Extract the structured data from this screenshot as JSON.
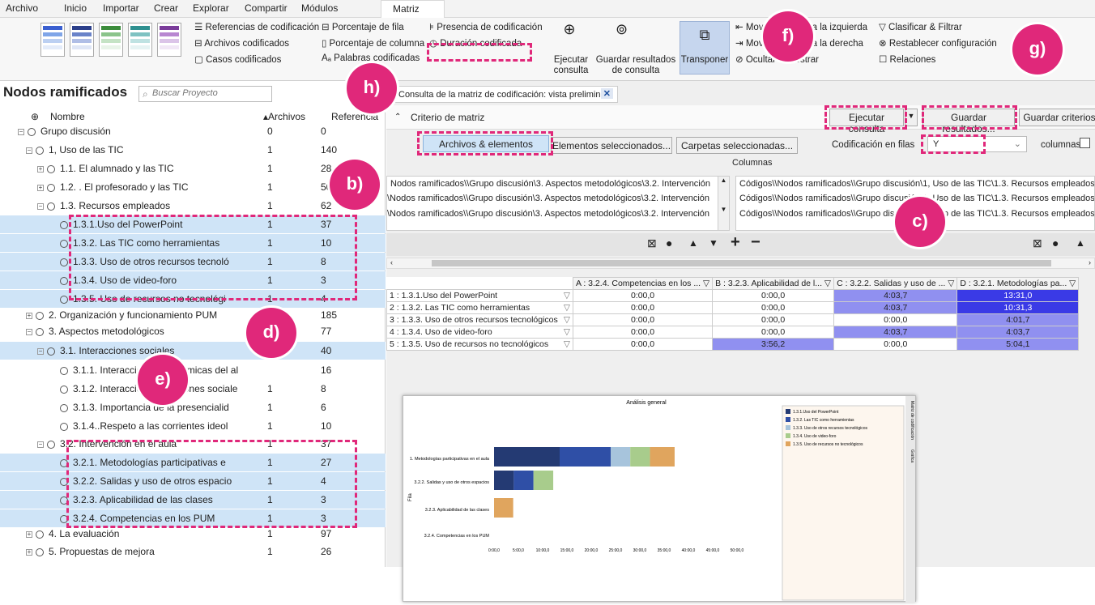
{
  "menu": [
    "Archivo",
    "Inicio",
    "Importar",
    "Crear",
    "Explorar",
    "Compartir",
    "Módulos",
    "Matriz"
  ],
  "ribbon": {
    "ref_cod": "Referencias de codificación",
    "arch_cod": "Archivos codificados",
    "casos_cod": "Casos codificados",
    "pct_fila": "Porcentaje de fila",
    "pct_col": "Porcentaje de columna",
    "palabras": "Palabras codificadas",
    "presencia": "Presencia de codificación",
    "duracion": "Duración codificada",
    "ejecutar": "Ejecutar consulta",
    "guardar_res": "Guardar resultados de consulta",
    "transponer": "Transponer",
    "mover_izq": "Mover columna a la izquierda",
    "mover_der": "Mover columna a la derecha",
    "ocultar": "Ocultar & mostrar",
    "clasificar": "Clasificar & Filtrar",
    "restablecer": "Restablecer configuración",
    "relaciones": "Relaciones"
  },
  "left": {
    "title": "Nodos ramificados",
    "search_placeholder": "Buscar Proyecto",
    "col_nombre": "Nombre",
    "col_archivos": "Archivos",
    "col_ref": "Referencia",
    "rows": [
      {
        "name": "Grupo discusión",
        "files": "0",
        "refs": "0"
      },
      {
        "name": "1, Uso de las TIC",
        "files": "1",
        "refs": "140"
      },
      {
        "name": "1.1. El alumnado y las TIC",
        "files": "1",
        "refs": "28"
      },
      {
        "name": "1.2. . El profesorado y las TIC",
        "files": "1",
        "refs": "50"
      },
      {
        "name": "1.3. Recursos empleados",
        "files": "1",
        "refs": "62"
      },
      {
        "name": "1.3.1.Uso del PowerPoint",
        "files": "1",
        "refs": "37"
      },
      {
        "name": "1.3.2. Las TIC como herramientas",
        "files": "1",
        "refs": "10"
      },
      {
        "name": "1.3.3. Uso de otros recursos tecnoló",
        "files": "1",
        "refs": "8"
      },
      {
        "name": "1.3.4. Uso de video-foro",
        "files": "1",
        "refs": "3"
      },
      {
        "name": "1.3.5. Uso de recursos no tecnológi",
        "files": "1",
        "refs": "4"
      },
      {
        "name": "2. Organización y funcionamiento PUM",
        "files": "",
        "refs": "185"
      },
      {
        "name": "3. Aspectos metodológicos",
        "files": "",
        "refs": "77"
      },
      {
        "name": "3.1. Interacciones sociales",
        "files": "",
        "refs": "40"
      },
      {
        "name": "3.1.1. Interacciones académicas del al",
        "files": "",
        "refs": "16"
      },
      {
        "name": "3.1.2. Interacciones relaciones sociale",
        "files": "1",
        "refs": "8"
      },
      {
        "name": "3.1.3. Importancia de la presencialid",
        "files": "1",
        "refs": "6"
      },
      {
        "name": "3.1.4..Respeto a las corrientes ideol",
        "files": "1",
        "refs": "10"
      },
      {
        "name": "3.2. Intervención en el aula",
        "files": "1",
        "refs": "37"
      },
      {
        "name": "3.2.1. Metodologías participativas e",
        "files": "1",
        "refs": "27"
      },
      {
        "name": "3.2.2. Salidas y uso de otros espacio",
        "files": "1",
        "refs": "4"
      },
      {
        "name": "3.2.3. Aplicabilidad de las clases",
        "files": "1",
        "refs": "3"
      },
      {
        "name": "3.2.4. Competencias en los PUM",
        "files": "1",
        "refs": "3"
      },
      {
        "name": "4. La evaluación",
        "files": "1",
        "refs": "97"
      },
      {
        "name": "5. Propuestas de mejora",
        "files": "1",
        "refs": "26"
      }
    ]
  },
  "tab": {
    "label": "Consulta de la matriz de codificación: vista prelimin"
  },
  "criteria": {
    "title": "Criterio de matriz",
    "ejecutar": "Ejecutar consulta",
    "guardar": "Guardar resultados...",
    "guardar_crit": "Guardar criterios",
    "tab1": "Archivos & elementos",
    "tab2": "Elementos seleccionados...",
    "tab3": "Carpetas seleccionadas...",
    "cod_filas": "Codificación en filas",
    "select_value": "Y",
    "columnas_lbl": "columnas",
    "columnas_hdr": "Columnas",
    "rows_left": [
      "Nodos ramificados\\\\Grupo discusión\\3. Aspectos metodológicos\\3.2. Intervención",
      "\\Nodos ramificados\\\\Grupo discusión\\3. Aspectos metodológicos\\3.2. Intervención",
      "\\Nodos ramificados\\\\Grupo discusión\\3. Aspectos metodológicos\\3.2. Intervención"
    ],
    "rows_right": [
      "Códigos\\\\Nodos ramificados\\\\Grupo discusión\\1, Uso de las TIC\\1.3. Recursos empleados\\1.",
      "Códigos\\\\Nodos ramificados\\\\Grupo discusión\\1, Uso de las TIC\\1.3. Recursos empleados\\1.",
      "Códigos\\\\Nodos ramificados\\\\Grupo discusión\\1, Uso de las TIC\\1.3. Recursos empleados\\1."
    ]
  },
  "matrix": {
    "headers": [
      "A : 3.2.4. Competencias en los ...",
      "B : 3.2.3. Aplicabilidad de l...",
      "C : 3.2.2. Salidas y uso de ...",
      "D : 3.2.1. Metodologías pa..."
    ],
    "rows": [
      {
        "label": "1 : 1.3.1.Uso del PowerPoint",
        "vals": [
          "0:00,0",
          "0:00,0",
          "4:03,7",
          "13:31,0"
        ]
      },
      {
        "label": "2 : 1.3.2. Las TIC como herramientas",
        "vals": [
          "0:00,0",
          "0:00,0",
          "4:03,7",
          "10:31,3"
        ]
      },
      {
        "label": "3 : 1.3.3. Uso de otros recursos tecnológicos",
        "vals": [
          "0:00,0",
          "0:00,0",
          "0:00,0",
          "4:01,7"
        ]
      },
      {
        "label": "4 : 1.3.4. Uso de video-foro",
        "vals": [
          "0:00,0",
          "0:00,0",
          "4:03,7",
          "4:03,7"
        ]
      },
      {
        "label": "5 : 1.3.5. Uso de recursos no tecnológicos",
        "vals": [
          "0:00,0",
          "3:56,2",
          "0:00,0",
          "5:04,1"
        ]
      }
    ]
  },
  "chart_data": {
    "type": "bar",
    "title": "Análisis general",
    "ylabel": "Fila",
    "categories": [
      "1. Metodologías participativas en el aula",
      "3.2.2. Salidas y uso de otros espacios",
      "3.2.3. Aplicabilidad de las clases",
      "3.2.4. Competencias en los PUM"
    ],
    "x_ticks": [
      "0:00,0",
      "5:00,0",
      "10:00,0",
      "15:00,0",
      "20:00,0",
      "25:00,0",
      "30:00,0",
      "35:00,0",
      "40:00,0",
      "45:00,0",
      "50:00,0"
    ],
    "series": [
      {
        "name": "1.3.1.Uso del PowerPoint",
        "color": "#243a73",
        "values": [
          13.5,
          4.06,
          0,
          0
        ]
      },
      {
        "name": "1.3.2. Las TIC como herramientas",
        "color": "#2f4fa6",
        "values": [
          10.5,
          4.06,
          0,
          0
        ]
      },
      {
        "name": "1.3.3. Uso de otros recursos tecnológicos",
        "color": "#a7c4dc",
        "values": [
          4.03,
          0,
          0,
          0
        ]
      },
      {
        "name": "1.3.4. Uso de video-foro",
        "color": "#a8cc8c",
        "values": [
          4.06,
          4.06,
          0,
          0
        ]
      },
      {
        "name": "1.3.5. Uso de recursos no tecnológicos",
        "color": "#e0a55e",
        "values": [
          5.07,
          0,
          3.94,
          0
        ]
      }
    ],
    "side_tabs": [
      "Matriz de codificación",
      "Gráfica"
    ]
  },
  "callouts": [
    "b)",
    "c)",
    "d)",
    "e)",
    "f)",
    "g)",
    "h)"
  ],
  "colors": {
    "accent": "#e0287a",
    "select": "#cfe4f7",
    "cell_dark": "#3a3ae6",
    "cell_mid": "#9090f0"
  }
}
